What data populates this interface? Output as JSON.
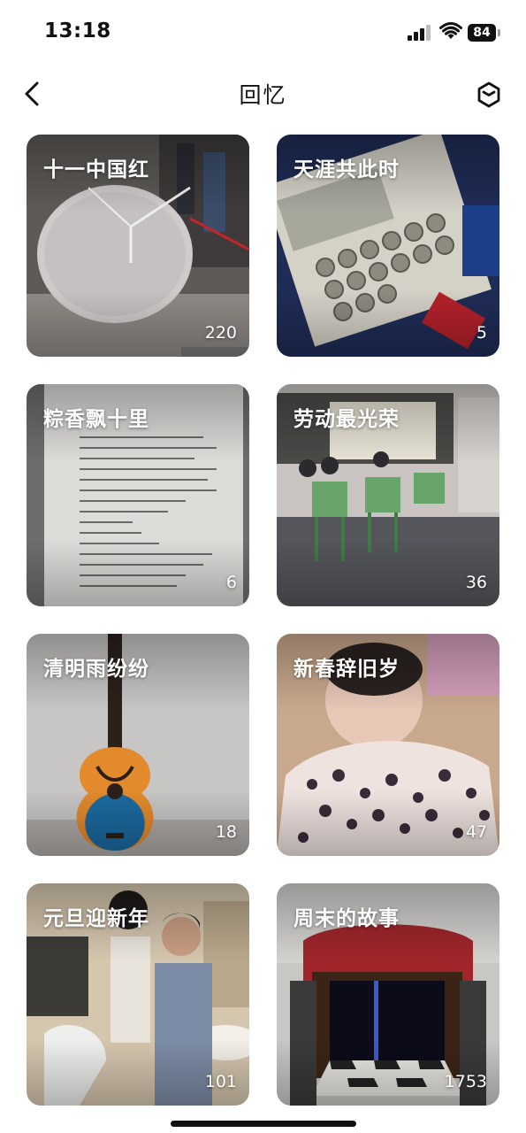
{
  "status_bar": {
    "time": "13:18",
    "battery": "84"
  },
  "header": {
    "title": "回忆"
  },
  "memories": [
    {
      "title": "十一中国红",
      "count": "220",
      "icon": "clock-sculpture"
    },
    {
      "title": "天涯共此时",
      "count": "5",
      "icon": "keypad"
    },
    {
      "title": "粽香飘十里",
      "count": "6",
      "icon": "worksheet"
    },
    {
      "title": "劳动最光荣",
      "count": "36",
      "icon": "classroom"
    },
    {
      "title": "清明雨纷纷",
      "count": "18",
      "icon": "ukulele"
    },
    {
      "title": "新春辞旧岁",
      "count": "47",
      "icon": "baby"
    },
    {
      "title": "元旦迎新年",
      "count": "101",
      "icon": "people-dinner"
    },
    {
      "title": "周末的故事",
      "count": "1753",
      "icon": "stage-gate"
    }
  ]
}
